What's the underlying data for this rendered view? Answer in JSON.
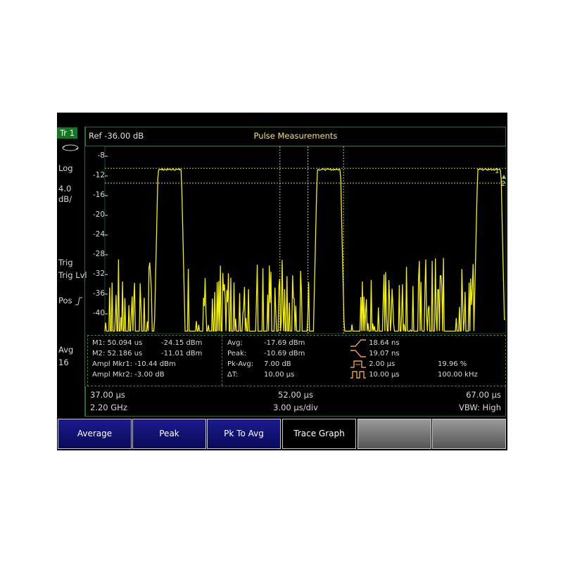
{
  "sidebar": {
    "trace": "Tr 1",
    "scale_type": "Log",
    "scale_value": "4.0",
    "scale_unit": "dB/",
    "trig": "Trig",
    "trig_lvl": "Trig Lvl",
    "pos": "Pos",
    "avg": "Avg",
    "avg_count": "16"
  },
  "header": {
    "ref": "Ref -36.00 dB",
    "title": "Pulse Measurements"
  },
  "plot": {
    "y_ticks": [
      "-8",
      "-12",
      "-16",
      "-20",
      "-24",
      "-28",
      "-32",
      "-36",
      "-40"
    ],
    "marker1_label": "1",
    "marker2_label": "2",
    "trace_color": "#f4f000",
    "marker_line_color": "#c8c88a",
    "grid_color": "#d8d8d8"
  },
  "chart_data": {
    "type": "line",
    "ylim": [
      -44,
      -6
    ],
    "xlim": [
      37.0,
      67.0
    ],
    "pulses_us": [
      [
        40.7,
        43.0
      ],
      [
        52.6,
        54.9
      ],
      [
        64.6,
        66.9
      ]
    ],
    "pulse_top_db": -10.7,
    "markers_db": [
      -10.44,
      -13.44
    ],
    "marker_x_us": [
      50.094,
      52.186,
      54.85
    ]
  },
  "info": {
    "m1": "M1:  50.094 us",
    "m1_val": "-24.15 dBm",
    "m2": "M2:  52.186 us",
    "m2_val": "-11.01 dBm",
    "ampl1": "Ampl Mkr1: -10.44  dBm",
    "ampl2": "Ampl Mkr2: -3.00 dB",
    "avg_label": "Avg:",
    "avg_val": "-17.69  dBm",
    "peak_label": "Peak:",
    "peak_val": "-10.69  dBm",
    "pkavg_label": "Pk-Avg:",
    "pkavg_val": "7.00  dB",
    "dt_label": "ΔT:",
    "dt_val": "10.00 μs",
    "rise": "18.64 ns",
    "fall": "19.07 ns",
    "width": "2.00 μs",
    "period": "10.00 μs",
    "duty": "19.96  %",
    "prf": "100.00 kHz"
  },
  "axis": {
    "start": "37.00 μs",
    "center": "52.00 μs",
    "stop": "67.00 μs",
    "freq": "2.20 GHz",
    "per_div": "3.00 μs/div",
    "vbw": "VBW: High"
  },
  "softkeys": [
    "Average",
    "Peak",
    "Pk To Avg",
    "Trace Graph",
    "",
    ""
  ]
}
